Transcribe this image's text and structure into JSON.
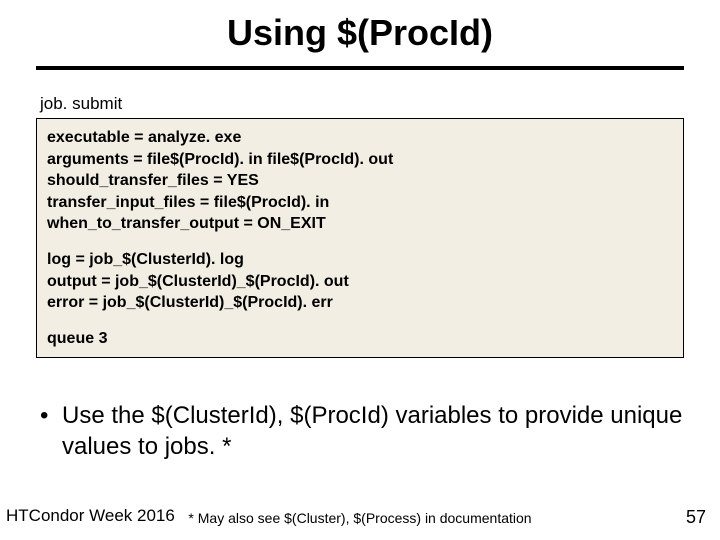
{
  "title": "Using $(ProcId)",
  "filename": "job. submit",
  "code": {
    "b1l1": "executable = analyze. exe",
    "b1l2": "arguments = file$(ProcId). in file$(ProcId). out",
    "b1l3": "should_transfer_files = YES",
    "b1l4": "transfer_input_files = file$(ProcId). in",
    "b1l5": "when_to_transfer_output = ON_EXIT",
    "b2l1": "log = job_$(ClusterId). log",
    "b2l2": "output = job_$(ClusterId)_$(ProcId). out",
    "b2l3": "error = job_$(ClusterId)_$(ProcId). err",
    "b3l1": "queue 3"
  },
  "bullet": {
    "pre": "Use the ",
    "var1": "$(ClusterId)",
    "sep": ", ",
    "var2": "$(ProcId)",
    "post": " variables to provide unique values to jobs. *"
  },
  "footer_left": "HTCondor Week 2016",
  "footnote": "* May also see $(Cluster), $(Process) in documentation",
  "pagenum": "57"
}
